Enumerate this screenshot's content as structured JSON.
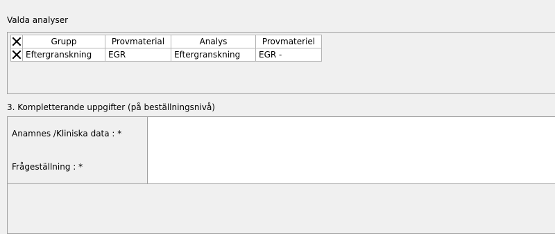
{
  "valda": {
    "title": "Valda analyser",
    "columns": [
      "",
      "Grupp",
      "Provmaterial",
      "Analys",
      "Provmateriel"
    ],
    "rows": [
      {
        "grupp": "Eftergranskning",
        "provmaterial": "EGR",
        "analys": "Eftergranskning",
        "provmateriel": "EGR -"
      }
    ]
  },
  "komp": {
    "title": "3. Kompletterande uppgifter (på beställningsnivå)",
    "fields": [
      {
        "label": "Anamnes /Kliniska data : *",
        "value": ""
      },
      {
        "label": "Frågeställning : *",
        "value": ""
      }
    ]
  },
  "icons": {
    "remove": "close-icon"
  }
}
